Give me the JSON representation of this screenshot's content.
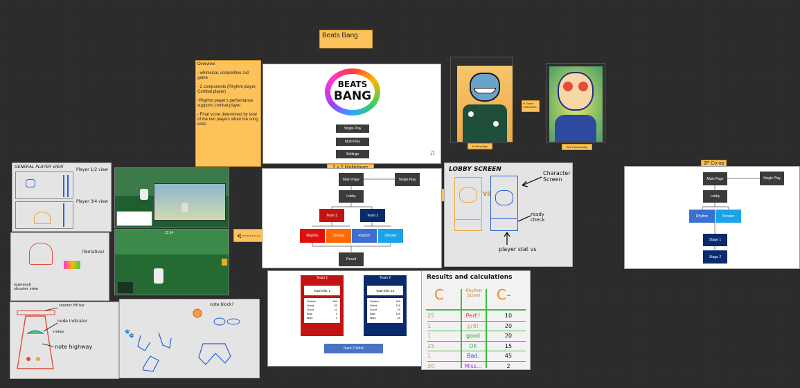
{
  "title": "Beats Bang",
  "overview": {
    "heading": "Overview:",
    "points": [
      "- whimsical, competitive 2v2 game",
      "- 2 components (Rhythm player, Combat player)",
      "-Rhythm player's performance supports combat player",
      "- Final score determined by total of the two players when the song ends"
    ]
  },
  "main_menu": {
    "logo_top": "BEATS",
    "logo_bottom": "BANG",
    "buttons": [
      "Single Play",
      "Multi Play",
      "Settings"
    ]
  },
  "characters": {
    "left_caption": "AI WhaySigh",
    "right_caption": "Sue PlanSweddy",
    "note": "In-Game Characters"
  },
  "flow_2v2": {
    "label": "2 v 2 Multiplayer",
    "main_page": "Main Page",
    "single_play": "Single Play",
    "lobby": "Lobby",
    "team1": "Team 1",
    "team2": "Team 2",
    "rhythm": "Rhythm",
    "shooter": "Shooter",
    "result": "Result"
  },
  "lobby_sketch": {
    "title": "LOBBY SCREEN",
    "vs": "VS",
    "character_screen": "Character Screen",
    "ready_check": "ready check",
    "player_stats": "player stat vs"
  },
  "flow_coop": {
    "label": "2P Co-op",
    "main_page": "Main Page",
    "single_play": "Single Play",
    "lobby": "Lobby",
    "rhythm": "Rhythm",
    "shooter": "Shooter",
    "stage1": "Stage 1",
    "stage2": "Stage 2"
  },
  "results_screen": {
    "team1": {
      "name": "Team 1",
      "kills": "Total Kills: 1",
      "stats": [
        [
          "Perfect:",
          "300"
        ],
        [
          "Great:",
          "50"
        ],
        [
          "Good:",
          "11"
        ],
        [
          "Bad:",
          "3"
        ],
        [
          "Miss:",
          "2"
        ]
      ]
    },
    "team2": {
      "name": "Team 2",
      "kills": "Total Kills: 10",
      "stats": [
        [
          "Perfect:",
          "100"
        ],
        [
          "Great:",
          "120"
        ],
        [
          "Good:",
          "20"
        ],
        [
          "Bad:",
          "120"
        ],
        [
          "Miss:",
          "40"
        ]
      ]
    },
    "winner": "Team 2 Wins!"
  },
  "calc_sketch": {
    "title": "Results and calculations",
    "headers": [
      "C",
      "Rhythm Score!",
      "C-"
    ],
    "rows": [
      [
        "25",
        "Perf.!",
        "10"
      ],
      [
        "1",
        "gr8!",
        "20"
      ],
      [
        "1",
        "good",
        "20"
      ],
      [
        "25",
        "OK",
        "15"
      ],
      [
        "1",
        "Bad.",
        "45"
      ],
      [
        "30",
        "Miss...",
        "2"
      ]
    ]
  },
  "sketches": {
    "general_player_view": "GENERAL PLAYER VIEW",
    "player_rhythm_view": "Player 1/2 view",
    "player_shooter_view": "Player 3/4 view",
    "tentative": "(Tentative)",
    "general_shooter_view": "(general) shooter view",
    "shooter_hp_bar": "shooter HP bar",
    "node_indicator": "node indicator",
    "note_highway": "note highway",
    "notes_label": "notes",
    "shoot_arrows": "note block?",
    "hud_timer": "11:54"
  },
  "colors": {
    "sticky": "#fdc25a",
    "team_red": "#c31414",
    "team_navy": "#0a2a6b",
    "rhythm_blue": "#3b6fd0",
    "shooter_cyan": "#1aa3e8",
    "orange": "#ff6a00"
  }
}
